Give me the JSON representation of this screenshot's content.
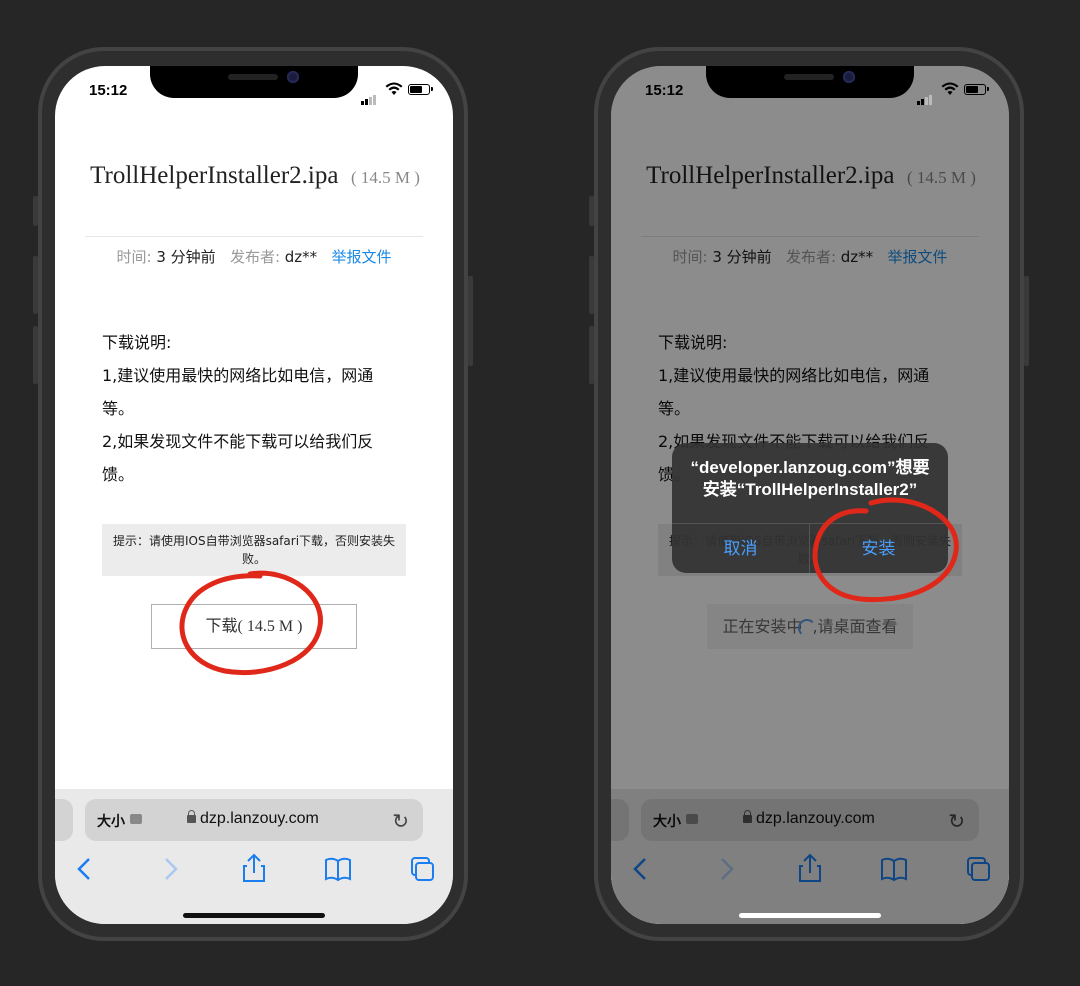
{
  "status_time": "15:12",
  "file": {
    "name": "TrollHelperInstaller2.ipa",
    "size_paren": "( 14.5 M )"
  },
  "meta": {
    "time_label": "时间:",
    "time_value": "3 分钟前",
    "publisher_label": "发布者:",
    "publisher_value": "dz**",
    "report_link": "举报文件"
  },
  "description": {
    "heading": "下载说明:",
    "line1": "1,建议使用最快的网络比如电信，网通等。",
    "line2": "2,如果发现文件不能下载可以给我们反馈。"
  },
  "tip": "提示：请使用IOS自带浏览器safari下载，否则安装失败。",
  "download_button": "下载( 14.5 M )",
  "installing_text_a": "正在安装中",
  "installing_text_b": ",请桌面查看",
  "safari": {
    "text_size": "大小",
    "url": "dzp.lanzouy.com"
  },
  "alert": {
    "message": "“developer.lanzoug.com”想要安装“TrollHelperInstaller2”",
    "cancel": "取消",
    "install": "安装"
  },
  "colors": {
    "annotation_red": "#e0281a",
    "link_blue": "#1a8ae5",
    "ios_blue": "#1a7ef0"
  },
  "icons": [
    "back-arrow-icon",
    "forward-arrow-icon",
    "share-icon",
    "bookmarks-icon",
    "tabs-icon",
    "reload-icon",
    "lock-icon",
    "wifi-icon",
    "battery-icon",
    "signal-icon"
  ]
}
